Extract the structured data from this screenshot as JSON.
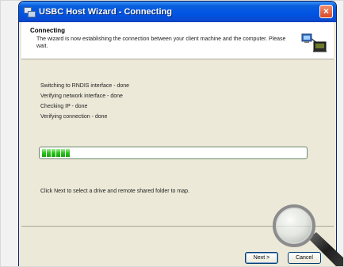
{
  "window": {
    "title": "USBC Host Wizard - Connecting",
    "close_glyph": "×"
  },
  "header": {
    "title": "Connecting",
    "description": "The wizard is now establishing the connection between your client machine and the computer. Please wait.",
    "icon": "network-computer-icon"
  },
  "status": [
    {
      "text": "Switching to RNDIS interface - done"
    },
    {
      "text": "Verifying network interface - done"
    },
    {
      "text": "Checking IP - done"
    },
    {
      "text": "Verifying connection - done"
    }
  ],
  "progress": {
    "fraction": 0.1,
    "color": "#2fc21f"
  },
  "instruction": "Click Next to select a drive and remote shared folder to map.",
  "buttons": {
    "next_label": "Next >",
    "cancel_label": "Cancel"
  },
  "overlay": {
    "icon": "magnifier-icon"
  }
}
